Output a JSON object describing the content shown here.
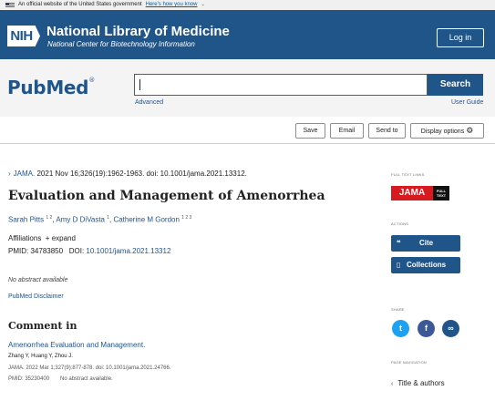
{
  "gov_banner": {
    "text": "An official website of the United States government",
    "link": "Here's how you know",
    "chevron": "⌄"
  },
  "header": {
    "logo": "NIH",
    "title": "National Library of Medicine",
    "subtitle": "National Center for Biotechnology Information",
    "login": "Log in"
  },
  "search": {
    "logo_text": "PubMed",
    "logo_reg": "®",
    "value": "",
    "button": "Search",
    "advanced": "Advanced",
    "user_guide": "User Guide"
  },
  "actions": {
    "save": "Save",
    "email": "Email",
    "send_to": "Send to",
    "display_options": "Display options"
  },
  "article": {
    "journal": "JAMA.",
    "citation": "2021 Nov 16;326(19):1962-1963. doi: 10.1001/jama.2021.13312.",
    "title": "Evaluation and Management of Amenorrhea",
    "authors": [
      {
        "name": "Sarah Pitts",
        "sup": "1 2"
      },
      {
        "name": "Amy D DiVasta",
        "sup": "1"
      },
      {
        "name": "Catherine M Gordon",
        "sup": "1 2 3"
      }
    ],
    "affiliations_label": "Affiliations",
    "expand_label": "expand",
    "pmid_label": "PMID:",
    "pmid": "34783850",
    "doi_label": "DOI:",
    "doi": "10.1001/jama.2021.13312",
    "no_abstract": "No abstract available",
    "disclaimer": "PubMed Disclaimer"
  },
  "comment": {
    "heading": "Comment in",
    "title": "Amenorrhea Evaluation and Management.",
    "authors": "Zhang Y, Huang Y, Zhou J.",
    "citation": "JAMA. 2022 Mar 1;327(9):877-878. doi: 10.1001/jama.2021.24766.",
    "pmid": "PMID: 35230400",
    "no_abstract": "No abstract available."
  },
  "sidebar": {
    "full_text_links": "FULL TEXT LINKS",
    "jama_logo": "JAMA",
    "jama_full_text": "FULL TEXT",
    "actions_label": "ACTIONS",
    "cite": "Cite",
    "collections": "Collections",
    "share_label": "SHARE",
    "page_navigation_label": "PAGE NAVIGATION",
    "nav_item": "Title & authors"
  },
  "colors": {
    "nih_blue": "#20558a",
    "link_blue": "#205493",
    "jama_red": "#d71920",
    "twitter": "#1da1f2",
    "facebook": "#3b5998"
  }
}
